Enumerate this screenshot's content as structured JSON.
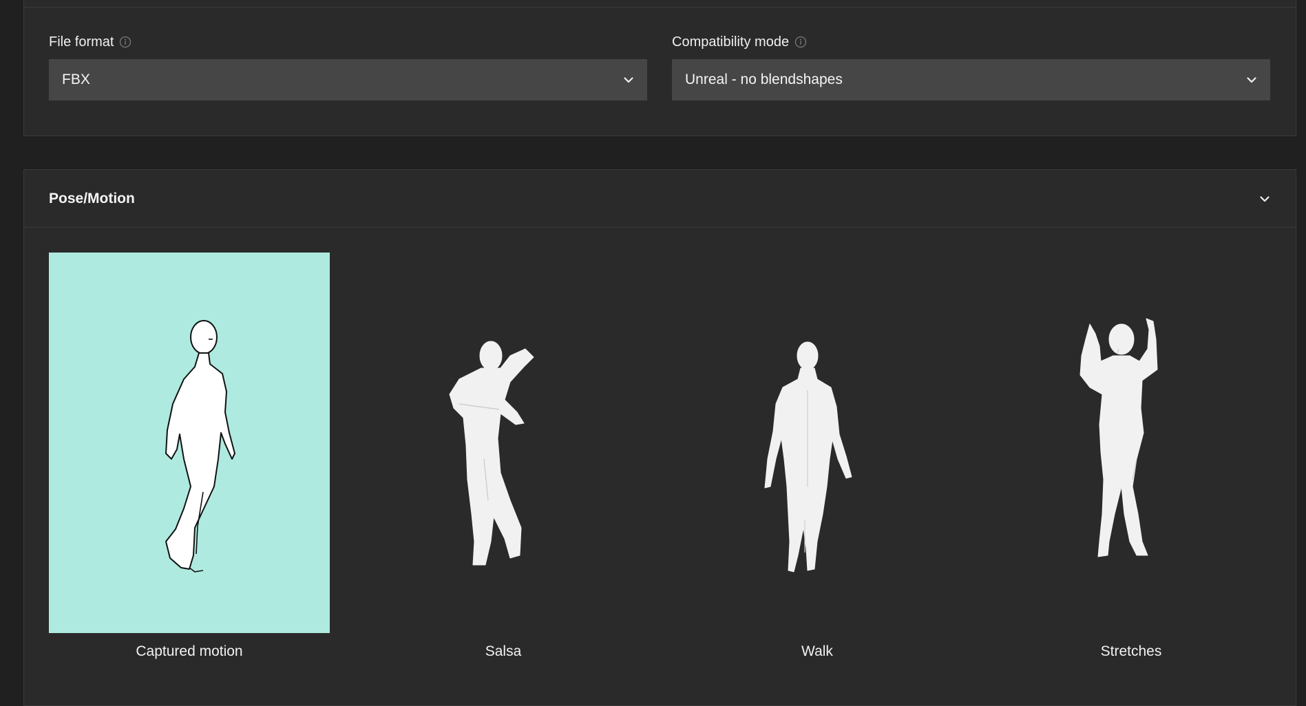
{
  "export": {
    "file_format": {
      "label": "File format",
      "value": "FBX",
      "icon": "info-icon"
    },
    "compatibility_mode": {
      "label": "Compatibility mode",
      "value": "Unreal - no blendshapes",
      "icon": "info-icon"
    }
  },
  "pose_motion": {
    "title": "Pose/Motion",
    "toggle_icon": "chevron-down-icon",
    "items": [
      {
        "label": "Captured motion",
        "selected": true
      },
      {
        "label": "Salsa",
        "selected": false
      },
      {
        "label": "Walk",
        "selected": false
      },
      {
        "label": "Stretches",
        "selected": false
      }
    ]
  },
  "colors": {
    "background": "#202020",
    "panel": "#2a2a2a",
    "select": "#464646",
    "selected_card": "#aeeadf"
  }
}
